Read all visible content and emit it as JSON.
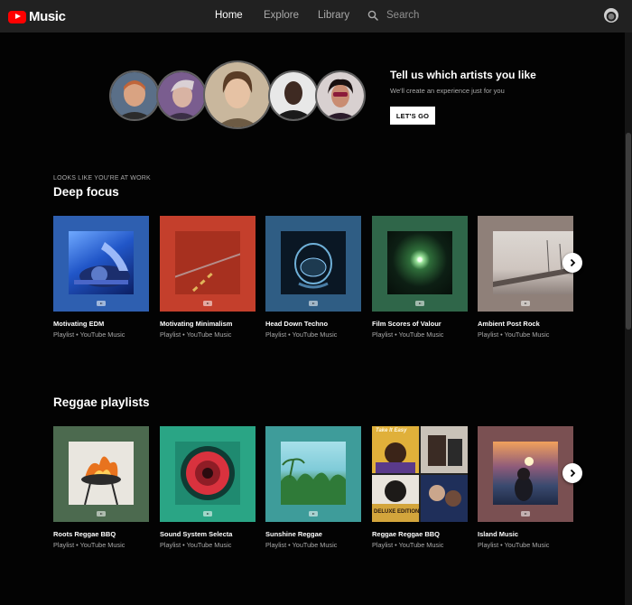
{
  "header": {
    "logo_text": "Music",
    "nav": [
      {
        "label": "Home",
        "active": true
      },
      {
        "label": "Explore",
        "active": false
      },
      {
        "label": "Library",
        "active": false
      }
    ],
    "search_label": "Search"
  },
  "promo": {
    "title": "Tell us which artists you like",
    "subtitle": "We'll create an experience just for you",
    "button": "LET'S GO"
  },
  "shelves": [
    {
      "strapline": "LOOKS LIKE YOU'RE AT WORK",
      "title": "Deep focus",
      "cards": [
        {
          "title": "Motivating EDM",
          "subtitle": "Playlist • YouTube Music"
        },
        {
          "title": "Motivating Minimalism",
          "subtitle": "Playlist • YouTube Music"
        },
        {
          "title": "Head Down Techno",
          "subtitle": "Playlist • YouTube Music"
        },
        {
          "title": "Film Scores of Valour",
          "subtitle": "Playlist • YouTube Music"
        },
        {
          "title": "Ambient Post Rock",
          "subtitle": "Playlist • YouTube Music"
        }
      ]
    },
    {
      "title": "Reggae playlists",
      "cards": [
        {
          "title": "Roots Reggae BBQ",
          "subtitle": "Playlist • YouTube Music"
        },
        {
          "title": "Sound System Selecta",
          "subtitle": "Playlist • YouTube Music"
        },
        {
          "title": "Sunshine Reggae",
          "subtitle": "Playlist • YouTube Music"
        },
        {
          "title": "Reggae Reggae BBQ",
          "subtitle": "Playlist • YouTube Music"
        },
        {
          "title": "Island Music",
          "subtitle": "Playlist • YouTube Music"
        }
      ]
    }
  ],
  "cover_art": {
    "reggae_bbq_panels": [
      "Take It Easy",
      "DELUXE EDITION"
    ]
  },
  "icons": {
    "logo": "youtube-play-icon",
    "search": "search-icon",
    "account": "account-icon",
    "next": "chevron-right-icon"
  },
  "colors": {
    "brand_red": "#ff0000",
    "background": "#030303",
    "topbar": "#212121",
    "secondary_text": "#aaaaaa"
  }
}
